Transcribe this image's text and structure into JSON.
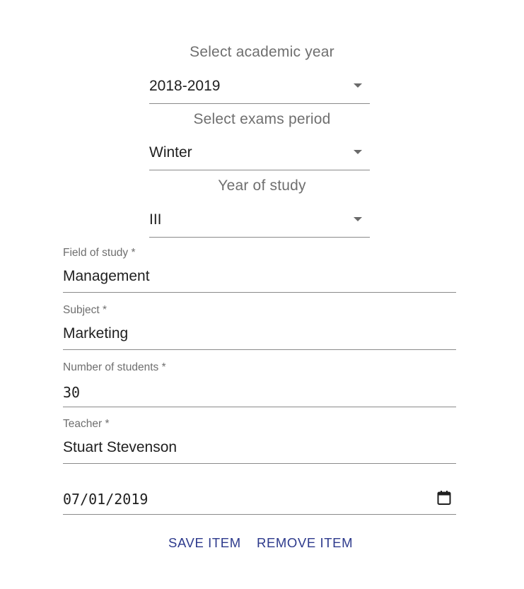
{
  "academic_year": {
    "label": "Select academic year",
    "value": "2018-2019"
  },
  "exams_period": {
    "label": "Select exams period",
    "value": "Winter"
  },
  "year_of_study": {
    "label": "Year of study",
    "value": "III"
  },
  "field_of_study": {
    "label": "Field of study *",
    "value": "Management"
  },
  "subject": {
    "label": "Subject *",
    "value": "Marketing"
  },
  "number_of_students": {
    "label": "Number of students *",
    "value": "30"
  },
  "teacher": {
    "label": "Teacher *",
    "value": "Stuart Stevenson"
  },
  "date": {
    "value": "07/01/2019",
    "icon": "calendar-icon"
  },
  "buttons": {
    "save": "SAVE ITEM",
    "remove": "REMOVE ITEM"
  },
  "colors": {
    "accent": "#2d3a8c",
    "label": "#6f6f6f",
    "text": "#1f1f1f",
    "underline": "#8a8a8a"
  }
}
